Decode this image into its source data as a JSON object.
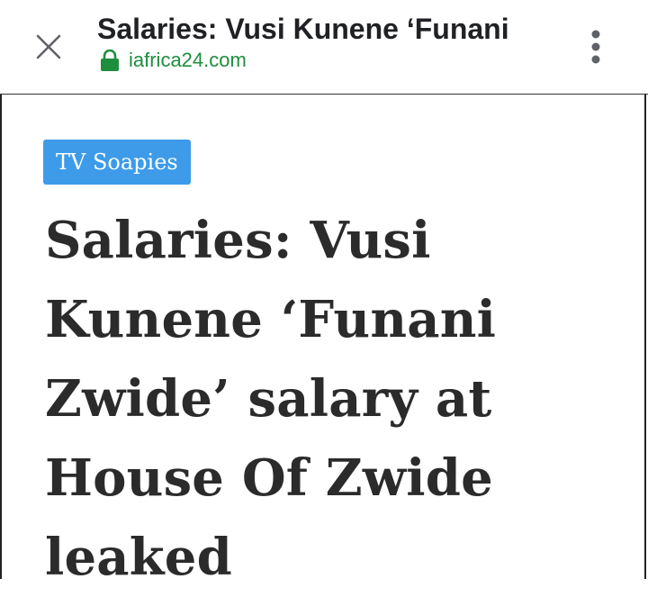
{
  "browser": {
    "title": "Salaries: Vusi Kunene ‘Funani",
    "url": "iafrica24.com",
    "close_icon": "close-icon",
    "lock_icon": "lock-icon",
    "menu_icon": "more-vert-icon",
    "url_color": "#1e8e3e"
  },
  "article": {
    "category": "TV Soapies",
    "category_color": "#3d9be9",
    "headline": "Salaries: Vusi Kunene ‘Funani Zwide’ salary at House Of Zwide leaked"
  }
}
